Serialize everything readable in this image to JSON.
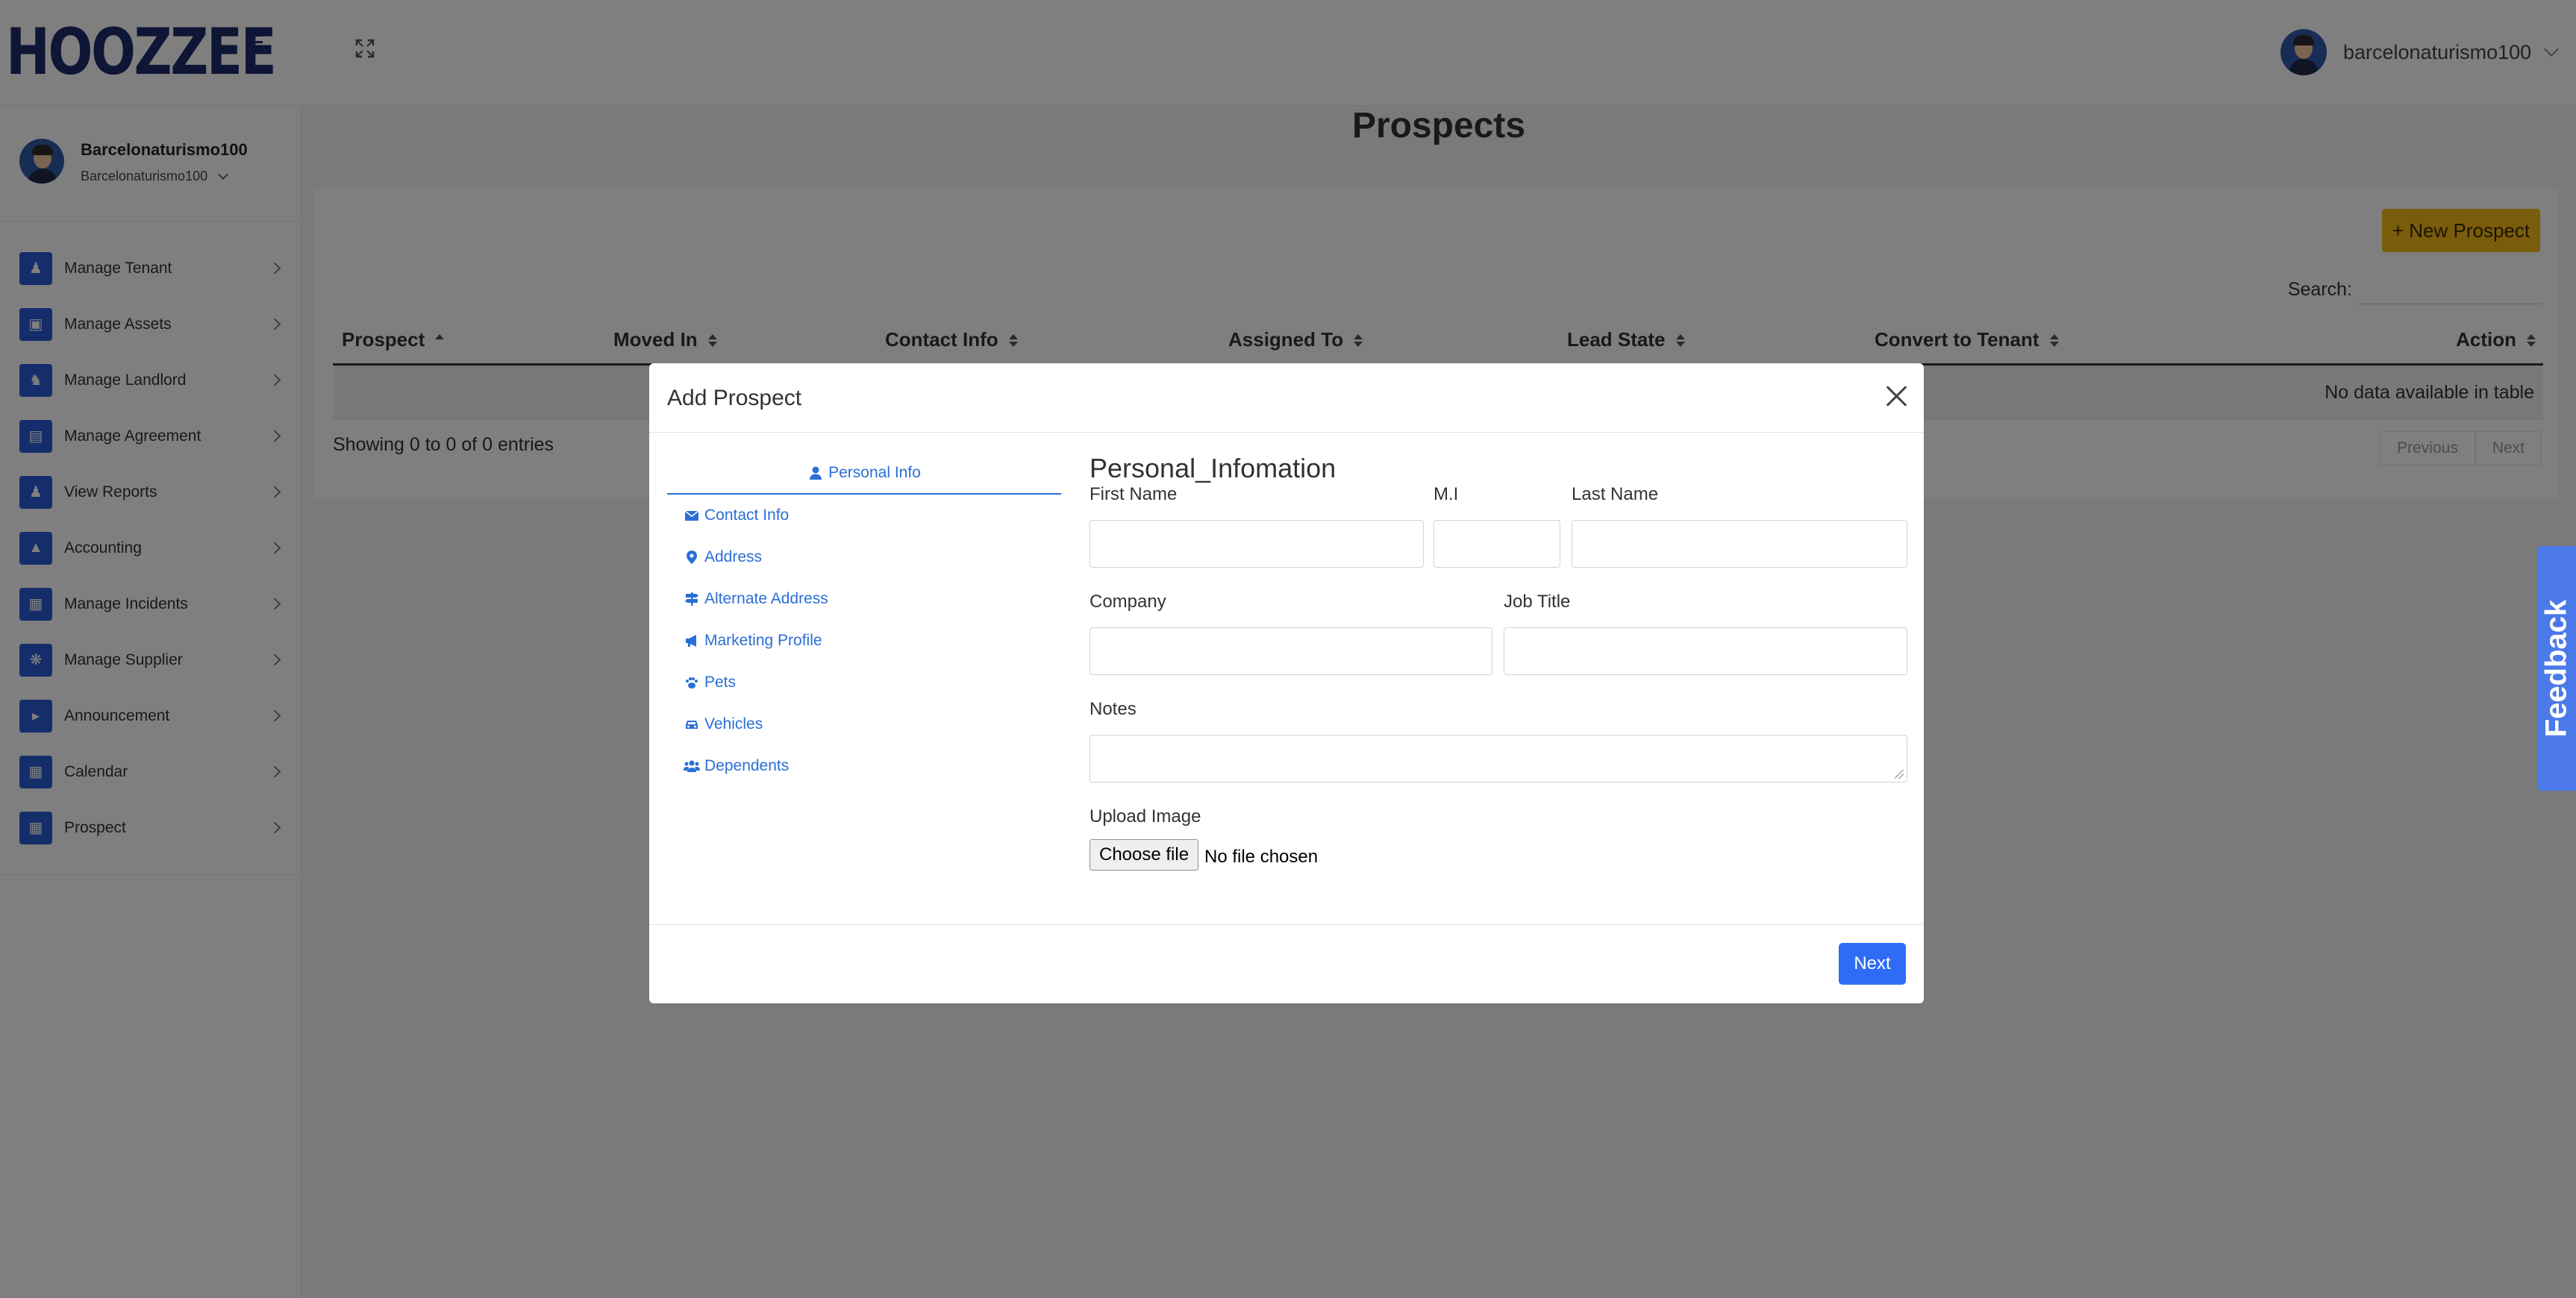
{
  "app": {
    "logo_text": "HOOZZEE",
    "top_user_name": "barcelonaturismo100"
  },
  "sidebar": {
    "user_name": "Barcelonaturismo100",
    "user_sub": "Barcelonaturismo100",
    "items": [
      {
        "label": "Manage Tenant",
        "icon": "tenant-icon"
      },
      {
        "label": "Manage Assets",
        "icon": "assets-icon"
      },
      {
        "label": "Manage Landlord",
        "icon": "landlord-icon"
      },
      {
        "label": "Manage Agreement",
        "icon": "agreement-icon"
      },
      {
        "label": "View Reports",
        "icon": "reports-icon"
      },
      {
        "label": "Accounting",
        "icon": "accounting-icon"
      },
      {
        "label": "Manage Incidents",
        "icon": "incidents-icon"
      },
      {
        "label": "Manage Supplier",
        "icon": "supplier-icon"
      },
      {
        "label": "Announcement",
        "icon": "announcement-icon"
      },
      {
        "label": "Calendar",
        "icon": "calendar-icon"
      },
      {
        "label": "Prospect",
        "icon": "prospect-icon"
      }
    ]
  },
  "main": {
    "title": "Prospects",
    "new_button": "+ New Prospect",
    "search_label": "Search:",
    "columns": [
      "Prospect",
      "Moved In",
      "Contact Info",
      "Assigned To",
      "Lead State",
      "Convert to Tenant",
      "Action"
    ],
    "empty_text": "No data available in table",
    "showing": "Showing 0 to 0 of 0 entries",
    "pager_prev": "Previous",
    "pager_next": "Next"
  },
  "feedback": "Feedback",
  "modal": {
    "title": "Add Prospect",
    "tabs": [
      {
        "label": "Personal Info",
        "icon": "user-icon",
        "active": true
      },
      {
        "label": "Contact Info",
        "icon": "envelope-icon"
      },
      {
        "label": "Address",
        "icon": "map-marker-icon"
      },
      {
        "label": "Alternate Address",
        "icon": "signs-icon"
      },
      {
        "label": "Marketing Profile",
        "icon": "bullhorn-icon"
      },
      {
        "label": "Pets",
        "icon": "paw-icon"
      },
      {
        "label": "Vehicles",
        "icon": "car-icon"
      },
      {
        "label": "Dependents",
        "icon": "users-icon"
      }
    ],
    "section_title": "Personal_Infomation",
    "fields": {
      "first_name": "First Name",
      "mi": "M.I",
      "last_name": "Last Name",
      "company": "Company",
      "job_title": "Job Title",
      "notes": "Notes",
      "upload_image": "Upload Image"
    },
    "file_button": "Choose file",
    "file_status": "No file chosen",
    "next_button": "Next"
  },
  "colors": {
    "brand": "#1d2a6b",
    "accent": "#2f6cf6",
    "new_button": "#f5b91b",
    "feedback": "#4c79ea"
  }
}
